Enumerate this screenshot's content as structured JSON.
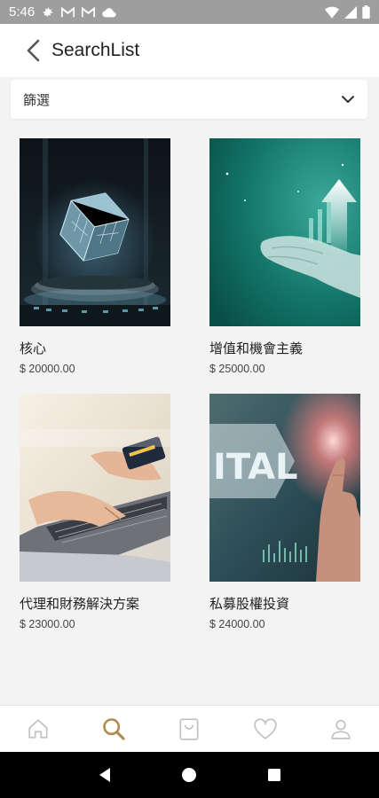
{
  "status_bar": {
    "time": "5:46",
    "icons": [
      "gear-icon",
      "gmail-icon",
      "gmail-icon",
      "cloud-icon",
      "wifi-icon",
      "signal-icon",
      "battery-icon"
    ]
  },
  "app_bar": {
    "title": "SearchList",
    "back_icon": "chevron-left-icon"
  },
  "filter": {
    "label": "篩選",
    "icon": "chevron-down-icon"
  },
  "products": [
    {
      "name": "核心",
      "price": "$ 20000.00",
      "image": "glowing-cube-on-pedestal"
    },
    {
      "name": "增值和機會主義",
      "price": "$ 25000.00",
      "image": "hand-with-up-arrow"
    },
    {
      "name": "代理和財務解決方案",
      "price": "$ 23000.00",
      "image": "hands-laptop-credit-card"
    },
    {
      "name": "私募股權投資",
      "price": "$ 24000.00",
      "image": "finger-touching-digital-screen"
    }
  ],
  "image_text": {
    "digital": "ITAL"
  },
  "bottom_nav": {
    "items": [
      "home-icon",
      "search-icon",
      "bag-icon",
      "heart-icon",
      "person-icon"
    ],
    "active": "search-icon"
  },
  "colors": {
    "accent": "#b08a52",
    "inactive": "#c2c2c2",
    "status_bar": "#9e9e9e"
  }
}
